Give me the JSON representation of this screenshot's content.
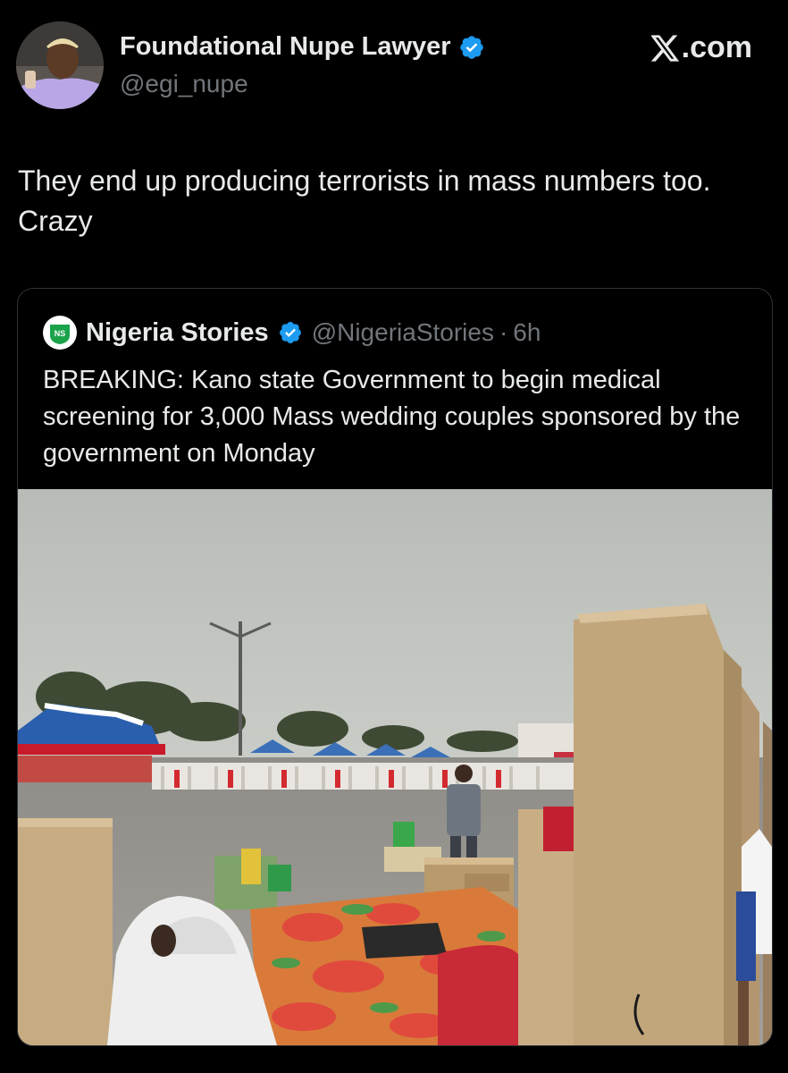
{
  "author": {
    "name": "Foundational Nupe Lawyer",
    "handle": "@egi_nupe",
    "verified_icon": "verified-badge-icon"
  },
  "brand": {
    "label": ".com",
    "logo_icon": "x-logo-icon"
  },
  "tweet": {
    "text": "They end up producing terrorists in mass numbers too. Crazy"
  },
  "quoted": {
    "avatar_text": "NS",
    "name": "Nigeria Stories",
    "handle": "@NigeriaStories",
    "separator": "·",
    "time": "6h",
    "text": "BREAKING: Kano state Government to begin medical screening for 3,000 Mass wedding couples sponsored by the government on Monday"
  },
  "colors": {
    "background": "#000000",
    "text": "#e7e9ea",
    "muted": "#71767b",
    "verified": "#1d9bf0",
    "border": "#2f3336"
  }
}
